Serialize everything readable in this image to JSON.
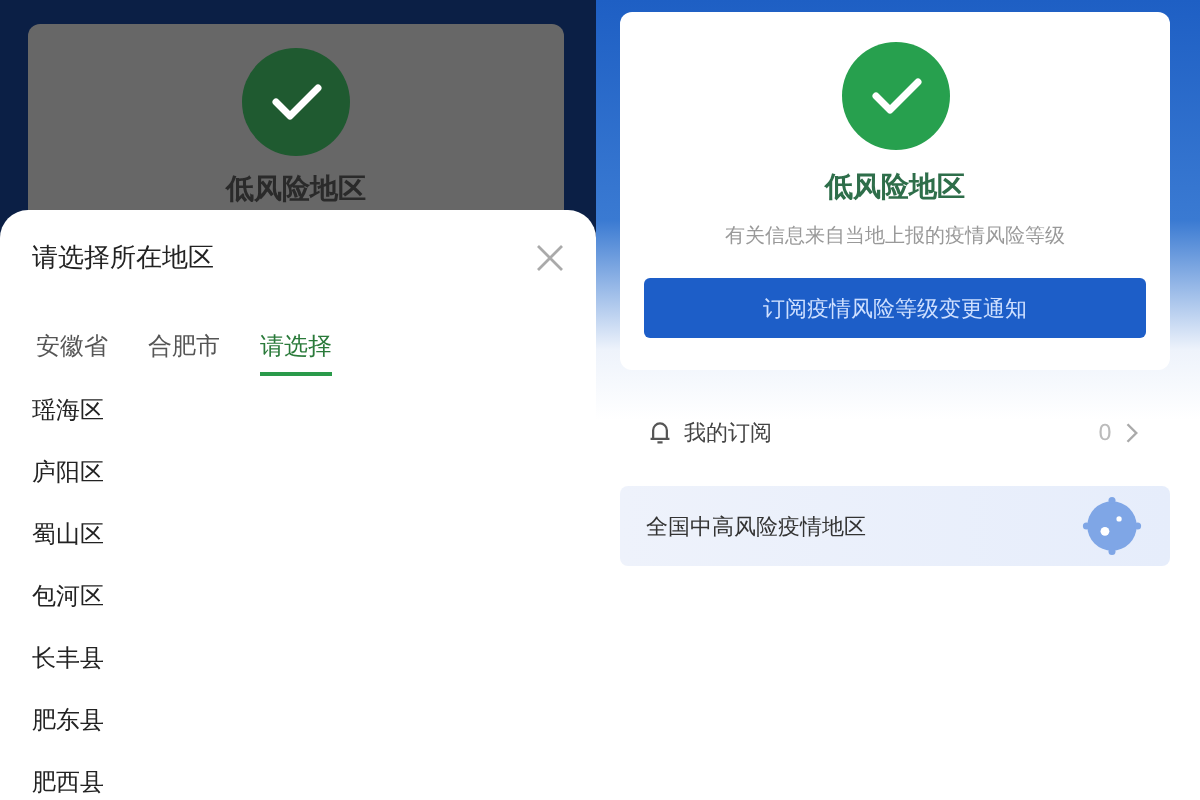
{
  "left_screen": {
    "status_card": {
      "title": "低风险地区"
    },
    "region_sheet": {
      "title": "请选择所在地区",
      "tabs": [
        {
          "label": "安徽省",
          "selected": false
        },
        {
          "label": "合肥市",
          "selected": false
        },
        {
          "label": "请选择",
          "selected": true
        }
      ],
      "districts": [
        "瑶海区",
        "庐阳区",
        "蜀山区",
        "包河区",
        "长丰县",
        "肥东县",
        "肥西县"
      ]
    }
  },
  "right_screen": {
    "status_card": {
      "title": "低风险地区",
      "subtitle": "有关信息来自当地上报的疫情风险等级",
      "button": "订阅疫情风险等级变更通知"
    },
    "subscriptions": {
      "label": "我的订阅",
      "count": "0"
    },
    "high_risk_link": {
      "label": "全国中高风险疫情地区"
    }
  }
}
